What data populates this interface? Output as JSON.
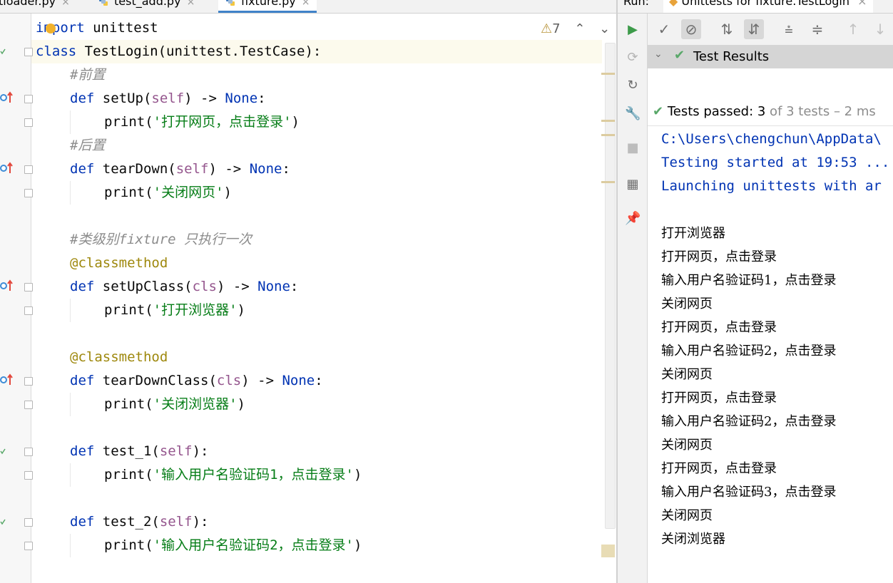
{
  "editor_tabs": [
    {
      "label": "tloader.py"
    },
    {
      "label": "test_add.py"
    },
    {
      "label": "fixture.py"
    }
  ],
  "tab_close": "×",
  "inspection": {
    "icon": "warning-icon",
    "count": "7"
  },
  "code_lines": {
    "l1_kw": "import",
    "l1_rest": " unittest",
    "l2_kw": "class",
    "l2_name": " TestLogin",
    "l2_rest": "(unittest.TestCase):",
    "l3": "#前置",
    "l4_kw": "def",
    "l4_name": " setUp(",
    "l4_self": "self",
    "l4_rest": ") -> ",
    "l4_none": "None",
    "l4_end": ":",
    "l5_fn": "print(",
    "l5_str": "'打开网页，点击登录'",
    "l5_end": ")",
    "l6": "#后置",
    "l7_kw": "def",
    "l7_name": " tearDown(",
    "l7_self": "self",
    "l7_rest": ") -> ",
    "l7_none": "None",
    "l7_end": ":",
    "l8_fn": "print(",
    "l8_str": "'关闭网页'",
    "l8_end": ")",
    "l10": "#类级别fixture 只执行一次",
    "l11": "@classmethod",
    "l12_kw": "def",
    "l12_name": " setUpClass(",
    "l12_self": "cls",
    "l12_rest": ") -> ",
    "l12_none": "None",
    "l12_end": ":",
    "l13_fn": "print(",
    "l13_str": "'打开浏览器'",
    "l13_end": ")",
    "l15": "@classmethod",
    "l16_kw": "def",
    "l16_name": " tearDownClass(",
    "l16_self": "cls",
    "l16_rest": ") -> ",
    "l16_none": "None",
    "l16_end": ":",
    "l17_fn": "print(",
    "l17_str": "'关闭浏览器'",
    "l17_end": ")",
    "l19_kw": "def",
    "l19_name": " test_1(",
    "l19_self": "self",
    "l19_end": "):",
    "l20_fn": "print(",
    "l20_str": "'输入用户名验证码1，点击登录'",
    "l20_end": ")",
    "l22_kw": "def",
    "l22_name": " test_2(",
    "l22_self": "self",
    "l22_end": "):",
    "l23_fn": "print(",
    "l23_str": "'输入用户名验证码2，点击登录'",
    "l23_end": ")"
  },
  "run_panel": {
    "run_label": "Run:",
    "config_tab": "Unittests for fixture.TestLogin",
    "tree_root": "Test Results",
    "status_prefix": "Tests passed: ",
    "status_passed": "3",
    "status_suffix": " of 3 tests – 2 ms"
  },
  "console": {
    "sys": [
      "C:\\Users\\chengchun\\AppData\\",
      "Testing started at 19:53 ...",
      "Launching unittests with ar"
    ],
    "out": [
      "打开浏览器",
      "打开网页，点击登录",
      "输入用户名验证码1，点击登录",
      "关闭网页",
      "打开网页，点击登录",
      "输入用户名验证码2，点击登录",
      "关闭网页",
      "打开网页，点击登录",
      "输入用户名验证码2，点击登录",
      "关闭网页",
      "打开网页，点击登录",
      "输入用户名验证码3，点击登录",
      "关闭网页",
      "关闭浏览器"
    ]
  },
  "colors": {
    "accent": "#4083c9",
    "pass": "#59a869",
    "keyword": "#0033b3",
    "string": "#067d17"
  }
}
